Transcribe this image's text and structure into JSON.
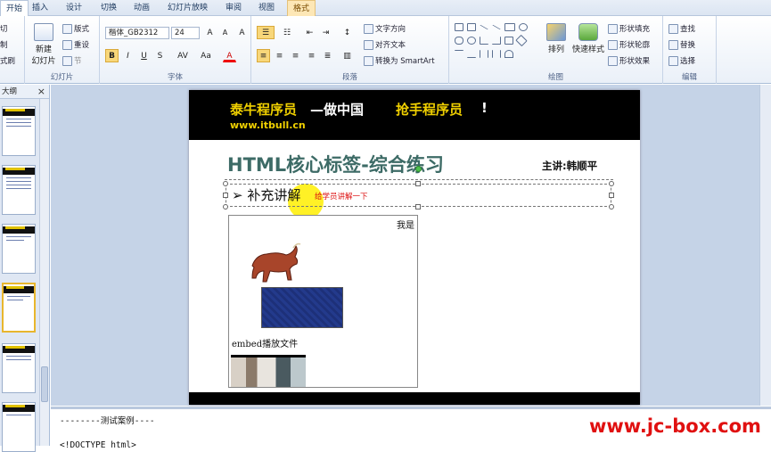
{
  "ribbon": {
    "tabs": [
      {
        "label": "开始",
        "active": true
      },
      {
        "label": "插入"
      },
      {
        "label": "设计"
      },
      {
        "label": "切换"
      },
      {
        "label": "动画"
      },
      {
        "label": "幻灯片放映"
      },
      {
        "label": "审阅"
      },
      {
        "label": "视图"
      },
      {
        "label": "格式",
        "contextual": true
      }
    ],
    "clipboard": {
      "cut": "切",
      "copy": "制",
      "format_painter": "式刷"
    },
    "slides": {
      "new_slide": "新建",
      "new_slide2": "幻灯片",
      "layout": "版式",
      "reset": "重设",
      "section": "节",
      "label": "幻灯片"
    },
    "font": {
      "family": "楷体_GB2312",
      "size": "24",
      "label": "字体",
      "grow": "A",
      "shrink": "A",
      "clear": "A",
      "bold": "B",
      "italic": "I",
      "underline": "U",
      "strike": "S",
      "spacing": "AV",
      "case": "Aa",
      "color": "A"
    },
    "paragraph": {
      "text_direction": "文字方向",
      "align_text": "对齐文本",
      "smartart": "转换为 SmartArt",
      "label": "段落"
    },
    "drawing": {
      "arrange": "排列",
      "quick_styles": "快速样式",
      "shape_fill": "形状填充",
      "shape_outline": "形状轮廓",
      "shape_effects": "形状效果",
      "label": "绘图"
    },
    "editing": {
      "find": "查找",
      "replace": "替换",
      "select": "选择",
      "label": "编辑"
    }
  },
  "left_panel": {
    "outline_tab": "大纲",
    "close": "×"
  },
  "slide": {
    "brand": "泰牛程序员",
    "slogan_pre": "—做中国",
    "slogan_highlight": "抢手程序员",
    "slogan_post": "!",
    "website": "www.itbull.cn",
    "title": "HTML核心标签-综合练习",
    "lecturer": "主讲:韩顺平",
    "bullet": "➢ 补充讲解",
    "note": "给学员讲解一下",
    "demo_caption": "我是",
    "embed_label": "embed播放文件"
  },
  "notes": {
    "line1": "--------测试案例----",
    "line2": "<!DOCTYPE html>"
  },
  "watermark": "www.jc-box.com",
  "colors": {
    "brand_yellow": "#f0d000",
    "title_teal": "#3d6b66",
    "note_red": "#dd1111",
    "watermark_red": "#e01010",
    "selection_yellow": "#ffee00"
  }
}
